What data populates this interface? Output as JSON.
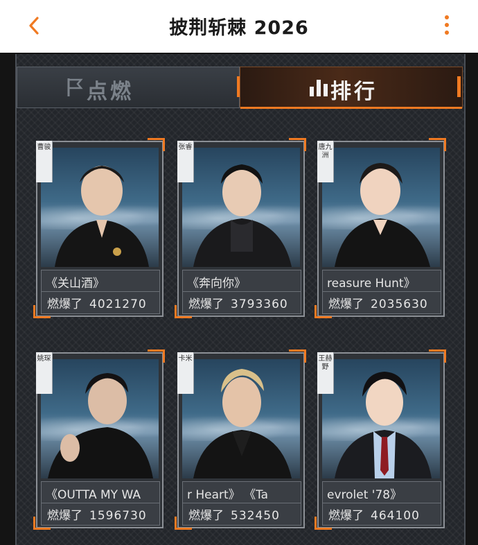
{
  "header": {
    "title": "披荆斩棘 2026"
  },
  "tabs": [
    {
      "label": "点燃",
      "icon": "flag-icon",
      "active": false
    },
    {
      "label": "排行",
      "icon": "bar-chart-icon",
      "active": true
    }
  ],
  "colors": {
    "accent": "#f07a22",
    "panel": "#23262b"
  },
  "count_label": "燃爆了",
  "cards": [
    {
      "name": "曹骏",
      "song": "《关山酒》",
      "count": "4021270"
    },
    {
      "name": "张睿",
      "song": "《奔向你》",
      "count": "3793360"
    },
    {
      "name": "唐九洲",
      "song": "reasure Hunt》",
      "count": "2035630"
    },
    {
      "name": "姚琛",
      "song": "《OUTTA MY WA",
      "count": "1596730"
    },
    {
      "name": "卡米",
      "song": "r Heart》  《Ta",
      "count": "532450"
    },
    {
      "name": "王赫野",
      "song": "evrolet '78》",
      "count": "464100"
    }
  ]
}
